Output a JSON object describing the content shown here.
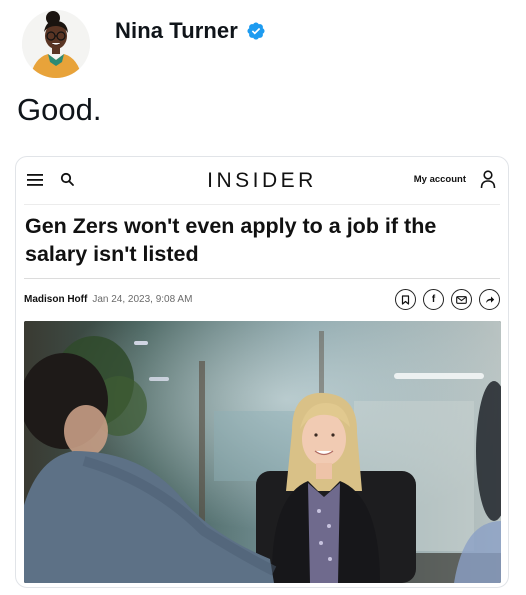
{
  "tweet": {
    "author_name": "Nina Turner",
    "text": "Good.",
    "icons": {
      "avatar": "avatar",
      "verified": "verified-badge-icon"
    },
    "colors": {
      "verified": "#1d9bf0"
    }
  },
  "article": {
    "header": {
      "brand": "INSIDER",
      "account_label": "My account",
      "icons": [
        "menu-icon",
        "search-icon",
        "user-icon"
      ]
    },
    "headline": "Gen Zers won't even apply to a job if the salary isn't listed",
    "byline": {
      "author": "Madison Hoff",
      "date": "Jan 24, 2023, 9:08 AM"
    },
    "share_buttons": [
      {
        "name": "bookmark-icon"
      },
      {
        "name": "facebook-icon",
        "glyph": "f"
      },
      {
        "name": "email-icon"
      },
      {
        "name": "share-icon"
      }
    ],
    "image": {
      "subject": "photo"
    }
  }
}
